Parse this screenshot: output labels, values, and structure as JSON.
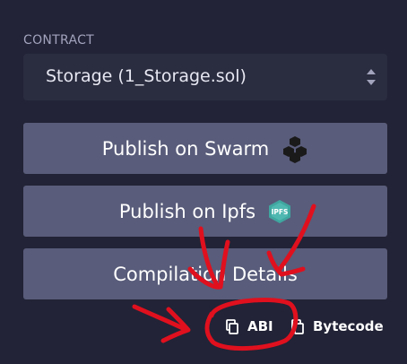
{
  "contract_section": {
    "label": "CONTRACT",
    "selected_contract": "Storage (1_Storage.sol)"
  },
  "buttons": {
    "publish_swarm": "Publish on Swarm",
    "publish_ipfs": "Publish on Ipfs",
    "compilation_details": "Compilation Details"
  },
  "icons": {
    "swarm": "swarm-cubes-icon",
    "ipfs": "ipfs-hexagon-icon",
    "ipfs_badge_text": "IPFS",
    "copy": "copy-icon"
  },
  "copy_links": {
    "abi": "ABI",
    "bytecode": "Bytecode"
  },
  "colors": {
    "background": "#222336",
    "select_bg": "#2a2c3f",
    "button_bg": "#595c7a",
    "annotation": "#e0101e",
    "ipfs_teal": "#3fa7a0"
  }
}
